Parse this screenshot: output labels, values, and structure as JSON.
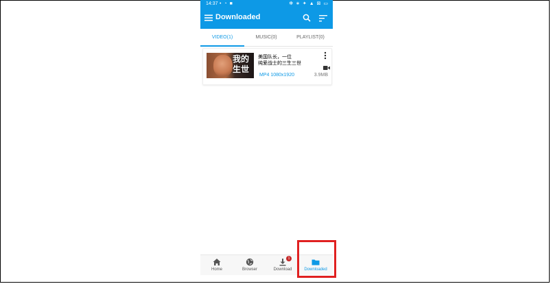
{
  "status_bar": {
    "time": "14:37",
    "left_icons": "• ◔ ■",
    "right_icons": "✻ ∗ ✦ ▲ ⊠ ▭"
  },
  "app_bar": {
    "title": "Downloaded",
    "menu_icon": "menu-icon",
    "search_icon": "search-icon",
    "sort_icon": "sort-icon"
  },
  "tabs": [
    {
      "label": "VIDEO(1)",
      "active": true
    },
    {
      "label": "MUSIC(0)",
      "active": false
    },
    {
      "label": "PLAYLIST(0)",
      "active": false
    }
  ],
  "video_item": {
    "thumbnail_text": "我的\n生世",
    "title_line1": "美国队长，一位",
    "title_line2": "纯爱战士的三生三世",
    "format": "MP4 1080x1920",
    "size": "3.9MB"
  },
  "bottom_nav": [
    {
      "label": "Home",
      "icon": "home-icon"
    },
    {
      "label": "Browser",
      "icon": "globe-icon"
    },
    {
      "label": "Download",
      "icon": "download-icon",
      "badge": "1"
    },
    {
      "label": "Downloaded",
      "icon": "folder-icon",
      "active": true
    }
  ],
  "colors": {
    "accent": "#0d99e6",
    "badge": "#c62828",
    "highlight": "#e02020"
  }
}
